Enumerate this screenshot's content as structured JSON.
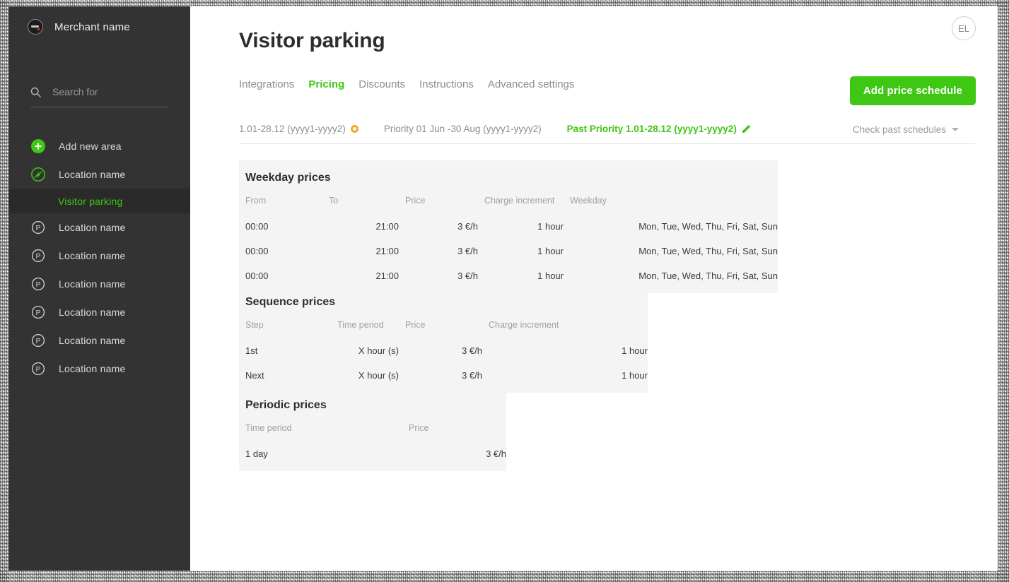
{
  "sidebar": {
    "brand": {
      "name": "Merchant name",
      "logo_icon": "merchant-logo-icon"
    },
    "search": {
      "placeholder": "Search for",
      "value": "",
      "icon": "search-icon"
    },
    "items": [
      {
        "label": "Add new area",
        "icon": "plus-circle-icon",
        "style": "plus"
      },
      {
        "label": "Location name",
        "icon": "ev-charger-icon",
        "style": "ev"
      },
      {
        "label": "Visitor parking",
        "icon": "",
        "style": "child",
        "active": true
      },
      {
        "label": "Location name",
        "icon": "parking-p-icon",
        "style": "p"
      },
      {
        "label": "Location name",
        "icon": "parking-p-icon",
        "style": "p"
      },
      {
        "label": "Location name",
        "icon": "parking-p-icon",
        "style": "p"
      },
      {
        "label": "Location name",
        "icon": "parking-p-icon",
        "style": "p"
      },
      {
        "label": "Location name",
        "icon": "parking-p-icon",
        "style": "p"
      },
      {
        "label": "Location name",
        "icon": "parking-p-icon",
        "style": "p"
      }
    ]
  },
  "header": {
    "title": "Visitor parking",
    "avatar_initials": "EL",
    "add_button_label": "Add price schedule"
  },
  "tabs": [
    {
      "label": "Integrations",
      "active": false
    },
    {
      "label": "Pricing",
      "active": true
    },
    {
      "label": "Discounts",
      "active": false
    },
    {
      "label": "Instructions",
      "active": false
    },
    {
      "label": "Advanced settings",
      "active": false
    }
  ],
  "schedules": {
    "items": [
      {
        "label": "1.01-28.12 (yyyy1-yyyy2)",
        "active": false,
        "icon": "orange-ring-icon"
      },
      {
        "label": "Priority 01 Jun -30 Aug (yyyy1-yyyy2)",
        "active": false,
        "icon": ""
      },
      {
        "label": "Past Priority 1.01-28.12 (yyyy1-yyyy2)",
        "active": true,
        "icon": "edit-pencil-icon"
      }
    ],
    "check_past_label": "Check past schedules"
  },
  "panels": {
    "weekday": {
      "title": "Weekday prices",
      "columns": [
        "From",
        "To",
        "Price",
        "Charge increment",
        "Weekday"
      ],
      "rows": [
        [
          "00:00",
          "21:00",
          "3 €/h",
          "1 hour",
          "Mon, Tue, Wed, Thu, Fri, Sat, Sun"
        ],
        [
          "00:00",
          "21:00",
          "3 €/h",
          "1 hour",
          "Mon, Tue, Wed, Thu, Fri, Sat, Sun"
        ],
        [
          "00:00",
          "21:00",
          "3 €/h",
          "1 hour",
          "Mon, Tue, Wed, Thu, Fri, Sat, Sun"
        ]
      ]
    },
    "sequence": {
      "title": "Sequence prices",
      "columns": [
        "Step",
        "Time period",
        "Price",
        "Charge increment"
      ],
      "rows": [
        [
          "1st",
          "X hour (s)",
          "3 €/h",
          "1 hour"
        ],
        [
          "Next",
          "X hour (s)",
          "3 €/h",
          "1 hour"
        ]
      ]
    },
    "periodic": {
      "title": "Periodic prices",
      "columns": [
        "Time period",
        "Price"
      ],
      "rows": [
        [
          "1 day",
          "3 €/h"
        ]
      ]
    }
  },
  "colors": {
    "accent_green": "#3ec713",
    "sidebar_bg": "#333333",
    "panel_bg": "#f4f4f4",
    "orange": "#f5a623"
  }
}
